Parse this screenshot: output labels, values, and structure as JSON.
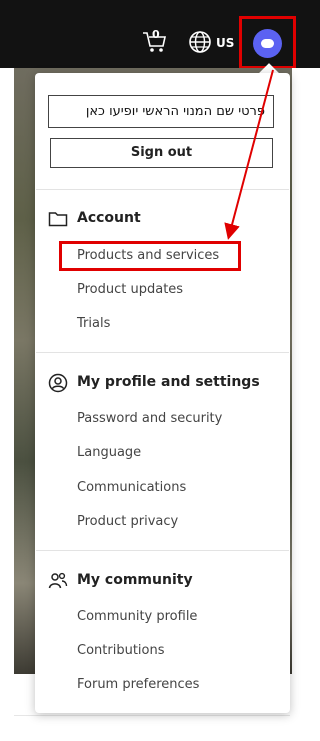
{
  "header": {
    "cart_count": "0",
    "region": "US"
  },
  "account_menu": {
    "name_placeholder": "פרטי שם המנוי הראשי יופיעו כאן",
    "sign_out_label": "Sign out",
    "sections": [
      {
        "title": "Account",
        "icon": "folder-icon",
        "items": [
          "Products and services",
          "Product updates",
          "Trials"
        ]
      },
      {
        "title": "My profile and settings",
        "icon": "user-circle-icon",
        "items": [
          "Password and security",
          "Language",
          "Communications",
          "Product privacy"
        ]
      },
      {
        "title": "My community",
        "icon": "community-icon",
        "items": [
          "Community profile",
          "Contributions",
          "Forum preferences"
        ]
      }
    ]
  },
  "colors": {
    "header_bg": "#121212",
    "avatar": "#5b62f2",
    "annotation": "#e00000"
  }
}
